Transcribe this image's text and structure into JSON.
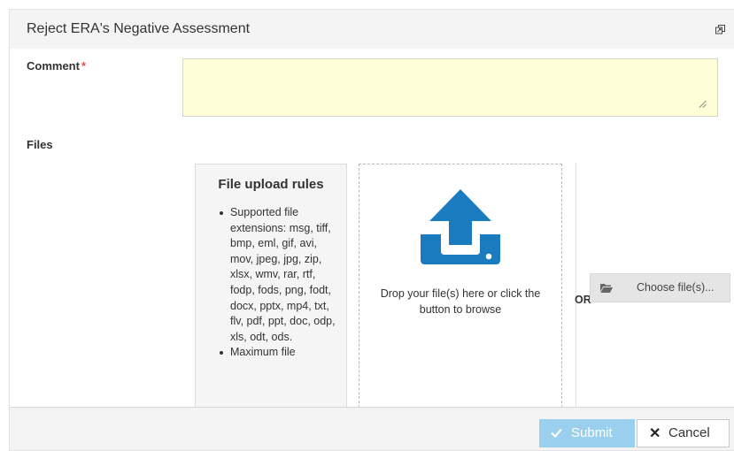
{
  "dialog": {
    "title": "Reject ERA's Negative Assessment",
    "restore_icon": "restore-window-icon"
  },
  "comment": {
    "label": "Comment",
    "required_mark": "*",
    "value": "",
    "background_color": "#fefdd6"
  },
  "files": {
    "label": "Files",
    "rules": {
      "title": "File upload rules",
      "items": [
        "Supported file extensions: msg, tiff, bmp, eml, gif, avi, mov, jpeg, jpg, zip, xlsx, wmv, rar, rtf, fodp, fods, png, fodt, docx, pptx, mp4, txt, flv, pdf, ppt, doc, odp, xls, odt, ods.",
        "Maximum file"
      ]
    },
    "dropzone": {
      "icon": "upload-icon",
      "text": "Drop your file(s) here or click the button to browse",
      "icon_color": "#1a7bbf"
    },
    "or_label": "OR",
    "choose_button": {
      "label": "Choose file(s)...",
      "icon": "folder-open-icon"
    }
  },
  "footer": {
    "submit_label": "Submit",
    "submit_icon": "check-icon",
    "submit_color": "#9ad0ee",
    "cancel_label": "Cancel",
    "cancel_icon": "close-icon"
  }
}
